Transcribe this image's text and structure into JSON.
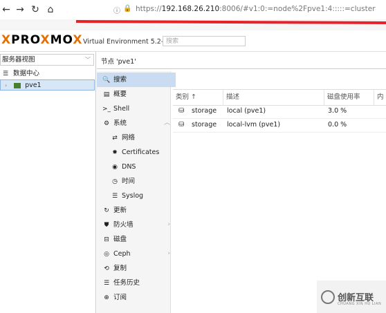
{
  "browser": {
    "url_prefix": "https://",
    "url_host": "192.168.26.210",
    "url_rest": ":8006/#v1:0:=node%2Fpve1:4:::::=cluster"
  },
  "header": {
    "logo_left": "PRO",
    "logo_x": "X",
    "logo_right": "MO",
    "logo_x2": "X",
    "version": "Virtual Environment 5.2-1",
    "search_placeholder": "搜索",
    "accent": "#e57000"
  },
  "tree": {
    "view": "服务器视图",
    "datacenter": "数据中心",
    "node": "pve1"
  },
  "node_title": "节点 'pve1'",
  "menu": [
    {
      "label": "搜索",
      "icon": "search-icon",
      "glyph": "🔍"
    },
    {
      "label": "概要",
      "icon": "book-icon",
      "glyph": "▤"
    },
    {
      "label": "Shell",
      "icon": "terminal-icon",
      "glyph": ">_"
    },
    {
      "label": "系统",
      "icon": "gears-icon",
      "glyph": "⚙"
    },
    {
      "label": "网络",
      "icon": "exchange-icon",
      "glyph": "⇄"
    },
    {
      "label": "Certificates",
      "icon": "certificate-icon",
      "glyph": "✹"
    },
    {
      "label": "DNS",
      "icon": "globe-icon",
      "glyph": "◉"
    },
    {
      "label": "时间",
      "icon": "clock-icon",
      "glyph": "◷"
    },
    {
      "label": "Syslog",
      "icon": "list-icon",
      "glyph": "☰"
    },
    {
      "label": "更新",
      "icon": "refresh-icon",
      "glyph": "↻"
    },
    {
      "label": "防火墙",
      "icon": "shield-icon",
      "glyph": "⛊"
    },
    {
      "label": "磁盘",
      "icon": "hdd-icon",
      "glyph": "⊟"
    },
    {
      "label": "Ceph",
      "icon": "ceph-icon",
      "glyph": "◎"
    },
    {
      "label": "复制",
      "icon": "retweet-icon",
      "glyph": "⟲"
    },
    {
      "label": "任务历史",
      "icon": "list-alt-icon",
      "glyph": "☰"
    },
    {
      "label": "订阅",
      "icon": "support-icon",
      "glyph": "⊕"
    }
  ],
  "grid": {
    "columns": [
      "类别 ↑",
      "描述",
      "磁盘使用率",
      "内"
    ],
    "rows": [
      {
        "type": "storage",
        "desc": "local (pve1)",
        "usage": "3.0 %"
      },
      {
        "type": "storage",
        "desc": "local-lvm (pve1)",
        "usage": "0.0 %"
      }
    ]
  },
  "watermark": {
    "text": "创新互联",
    "sub": "CHUANG XIN HU LIAN"
  }
}
